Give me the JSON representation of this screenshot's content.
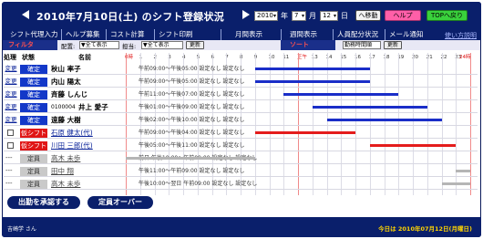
{
  "header": {
    "title": "2010年7月10日(土) のシフト登録状況",
    "year": "2010",
    "year_unit": "年",
    "month": "7",
    "month_unit": "月",
    "day": "12",
    "day_unit": "日",
    "move_label": "へ移動",
    "help_label": "ヘルプ",
    "top_label": "TOPへ戻り"
  },
  "tabs": [
    {
      "label": "シフト代理入力"
    },
    {
      "label": "ヘルプ募集"
    },
    {
      "label": "コスト計算"
    },
    {
      "label": "シフト印刷"
    },
    {
      "label": "月間表示"
    },
    {
      "label": "週間表示"
    },
    {
      "label": "人員配分状況"
    },
    {
      "label": "メール通知"
    }
  ],
  "tab_help_link": "使い方説明",
  "filter": {
    "filter_label": "フィルタ",
    "dept_label": "配置:",
    "dept_value": "▼全て表示",
    "role_label": "担当:",
    "role_value": "▼全て表示",
    "update_label": "更新",
    "sort_label": "ソート",
    "sort_value": "勤務時間順",
    "sort_update_label": "更新"
  },
  "columns": {
    "action": "処理",
    "status": "状態",
    "name": "名前"
  },
  "time_labels": [
    "0時",
    "1",
    "2",
    "3",
    "4",
    "5",
    "6",
    "7",
    "8",
    "9",
    "10",
    "11",
    "正午",
    "13",
    "14",
    "15",
    "16",
    "17",
    "18",
    "19",
    "20",
    "21",
    "22",
    "23",
    "24時"
  ],
  "rows": [
    {
      "action": "変更",
      "status": "確定",
      "status_color": "blue",
      "name": "秋山 率子",
      "time_text": "午前09:00～午後05:00 設定なし 設定なし",
      "bars": [
        {
          "color": "blue",
          "start": 9,
          "end": 17
        }
      ]
    },
    {
      "action": "変更",
      "status": "確定",
      "status_color": "blue",
      "name": "内山 陽太",
      "time_text": "午前09:00～午後05:00 設定なし 設定なし",
      "bars": [
        {
          "color": "blue",
          "start": 9,
          "end": 17
        }
      ]
    },
    {
      "action": "変更",
      "status": "確定",
      "status_color": "blue",
      "name": "斉藤 しんじ",
      "time_text": "午前11:00～午後07:00 設定なし 設定なし",
      "bars": [
        {
          "color": "blue",
          "start": 11,
          "end": 19
        }
      ]
    },
    {
      "action": "変更",
      "status": "確定",
      "status_color": "blue",
      "name_id": "0100004",
      "name": "井上 愛子",
      "time_text": "午後01:00～午後09:00 設定なし 設定なし",
      "bars": [
        {
          "color": "blue",
          "start": 13,
          "end": 21
        }
      ]
    },
    {
      "action": "変更",
      "status": "確定",
      "status_color": "blue",
      "name": "遠藤 大樹",
      "time_text": "午後02:00～午後10:00 設定なし 設定なし",
      "bars": [
        {
          "color": "blue",
          "start": 14,
          "end": 22
        }
      ]
    },
    {
      "action": "check",
      "status": "仮シフト",
      "status_color": "red",
      "name": "石原 健太(代)",
      "time_text": "午前09:00～午後04:00 設定なし 設定なし",
      "bars": [
        {
          "color": "red",
          "start": 9,
          "end": 16
        }
      ]
    },
    {
      "action": "check",
      "status": "仮シフト",
      "status_color": "red",
      "name": "川田 三郎(代)",
      "time_text": "午後05:00～午後11:00 設定なし 設定なし",
      "bars": [
        {
          "color": "red",
          "start": 17,
          "end": 23
        }
      ]
    },
    {
      "action": "---",
      "status": "定員",
      "status_color": "gray",
      "name": "高木 未歩",
      "time_text": "前日 午後10:00～午前09:00 設定なし 設定なし",
      "bars": [
        {
          "color": "gray",
          "start": 0,
          "end": 9
        }
      ]
    },
    {
      "action": "---",
      "status": "定員",
      "status_color": "gray",
      "name": "田中 翔",
      "time_text": "午後11:00～午前09:00 設定なし 設定なし",
      "bars": [
        {
          "color": "gray",
          "start": 23,
          "end": 24
        }
      ]
    },
    {
      "action": "---",
      "status": "定員",
      "status_color": "gray",
      "name": "高木 未歩",
      "time_text": "午後10:00～翌日 午前09:00 設定なし 設定なし",
      "bars": [
        {
          "color": "gray",
          "start": 22,
          "end": 24
        }
      ]
    }
  ],
  "actions": {
    "approve": "出勤を承認する",
    "over": "定員オーバー"
  },
  "footer": {
    "user": "吉崎学 さん",
    "today": "今日は 2010年07月12日(月曜日)"
  }
}
